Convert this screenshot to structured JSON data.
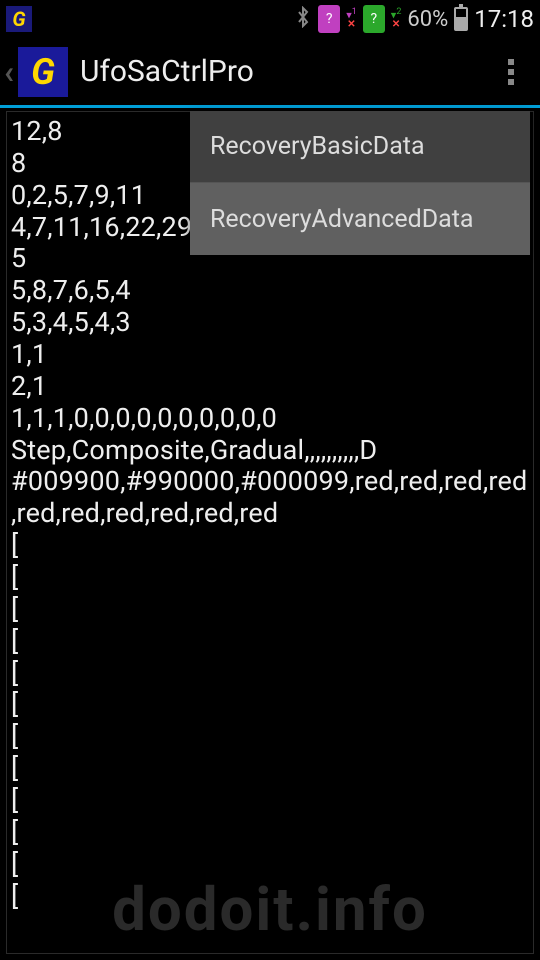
{
  "status": {
    "battery_percent": "60%",
    "time": "17:18",
    "sim1_label": "?",
    "sim2_label": "?",
    "signal1_top": "1",
    "signal2_top": "2"
  },
  "actionbar": {
    "title": "UfoSaCtrlPro"
  },
  "menu": {
    "items": [
      {
        "label": "RecoveryBasicData",
        "highlighted": false
      },
      {
        "label": "RecoveryAdvancedData",
        "highlighted": true
      }
    ]
  },
  "editor": {
    "text": "12,8\n8\n0,2,5,7,9,11\n4,7,11,16,22,29,\n5\n5,8,7,6,5,4\n5,3,4,5,4,3\n1,1\n2,1\n1,1,1,0,0,0,0,0,0,0,0,0,0\nStep,Composite,Gradual,,,,,,,,,,D\n#009900,#990000,#000099,red,red,red,red,red,red,red,red,red,red\n[\n[\n[\n[\n[\n[\n[\n[\n[\n[\n[\n["
  },
  "watermark": "dodoit.info"
}
